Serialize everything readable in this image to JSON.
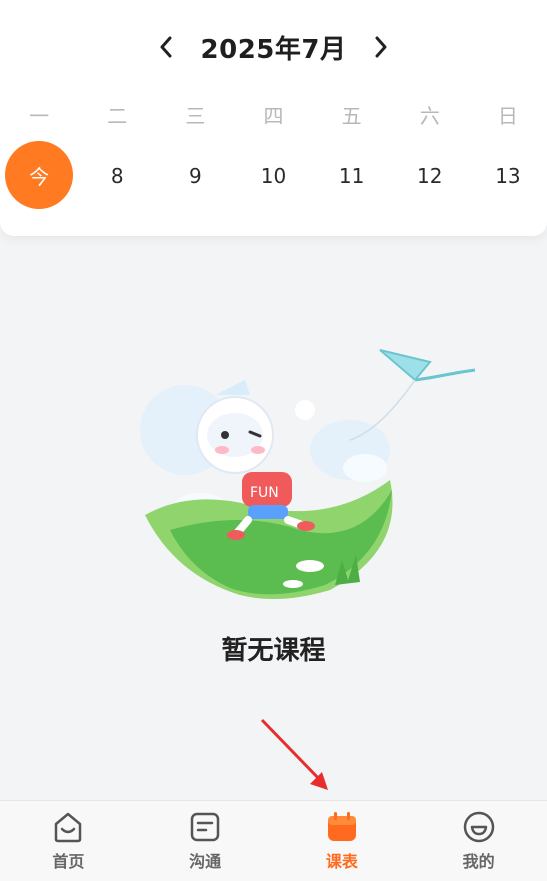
{
  "calendar": {
    "month_title": "2025年7月",
    "weekdays": [
      "一",
      "二",
      "三",
      "四",
      "五",
      "六",
      "日"
    ],
    "dates": [
      "今",
      "8",
      "9",
      "10",
      "11",
      "12",
      "13"
    ],
    "selected_index": 0
  },
  "empty_state": {
    "message": "暂无课程",
    "illustration_text": "FUN"
  },
  "tabbar": {
    "items": [
      {
        "label": "首页",
        "icon": "home-icon",
        "active": false
      },
      {
        "label": "沟通",
        "icon": "message-icon",
        "active": false
      },
      {
        "label": "课表",
        "icon": "calendar-icon",
        "active": true
      },
      {
        "label": "我的",
        "icon": "profile-icon",
        "active": false
      }
    ]
  },
  "colors": {
    "accent": "#ff7a21",
    "active_tab": "#ff6a1f",
    "arrow": "#e62e2e"
  }
}
